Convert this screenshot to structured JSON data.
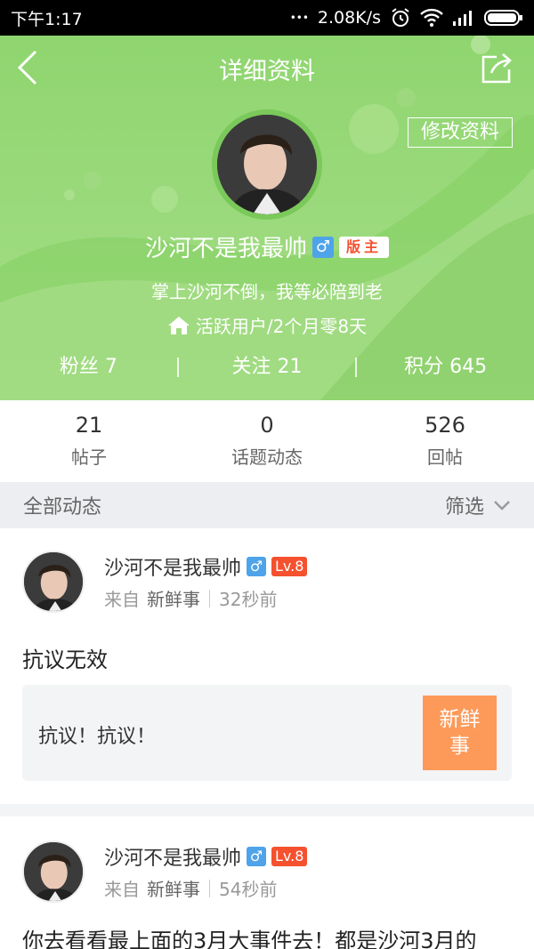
{
  "status_bar": {
    "time": "下午1:17",
    "dots": "•••",
    "speed": "2.08K/s"
  },
  "nav": {
    "title": "详细资料"
  },
  "profile": {
    "edit_label": "修改资料",
    "name": "沙河不是我最帅",
    "gender_symbol": "♂",
    "role_badge": "版主",
    "signature": "掌上沙河不倒，我等必陪到老",
    "active_status": "活跃用户/2个月零8天",
    "stats": {
      "fans": "粉丝 7",
      "following": "关注 21",
      "points": "积分 645"
    }
  },
  "counts": [
    {
      "value": "21",
      "label": "帖子"
    },
    {
      "value": "0",
      "label": "话题动态"
    },
    {
      "value": "526",
      "label": "回帖"
    }
  ],
  "filter": {
    "title": "全部动态",
    "button": "筛选"
  },
  "posts": [
    {
      "author": "沙河不是我最帅",
      "gender_symbol": "♂",
      "level": "Lv.8",
      "from_label": "来自",
      "source": "新鲜事",
      "time": "32秒前",
      "text": "抗议无效",
      "quote_text": "抗议！抗议！",
      "quote_tag_line1": "新鲜",
      "quote_tag_line2": "事"
    },
    {
      "author": "沙河不是我最帅",
      "gender_symbol": "♂",
      "level": "Lv.8",
      "from_label": "来自",
      "source": "新鲜事",
      "time": "54秒前",
      "text": "你去看看最上面的3月大事件去！都是沙河3月的"
    }
  ],
  "colors": {
    "header_green": "#9ad97b",
    "badge_orange": "#f5512f",
    "gender_blue": "#4fa3e9",
    "tag_orange": "#fd9a5a"
  }
}
